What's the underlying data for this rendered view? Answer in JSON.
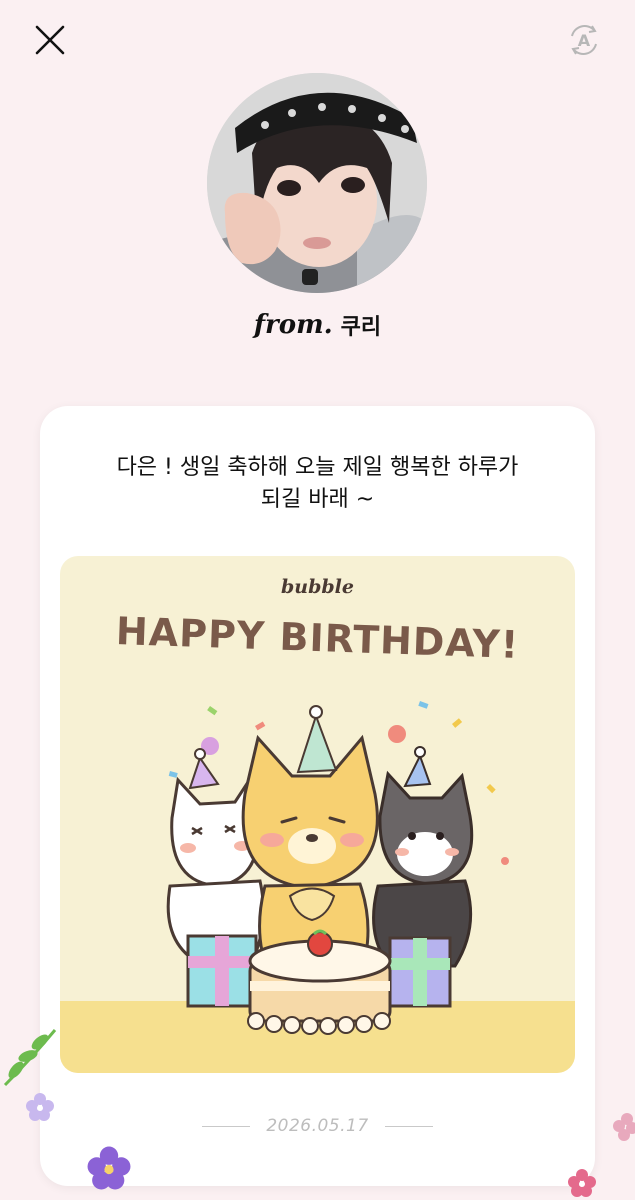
{
  "header": {
    "close_icon": "close-icon",
    "translate_icon": "translate-icon",
    "translate_letter": "A"
  },
  "sender": {
    "from_label": "from.",
    "name": "쿠리"
  },
  "letter": {
    "message": "다은 ! 생일 축하해 오늘 제일 행복한 하루가\n되길 바래 ~",
    "sticker": {
      "brand": "bubble",
      "title": "HAPPY BIRTHDAY!"
    },
    "date": "2026.05.17"
  },
  "colors": {
    "background": "#fbf0f2",
    "card": "#ffffff",
    "sticker_bg": "#f7f1d4",
    "title_brown": "#7a5a4a"
  }
}
